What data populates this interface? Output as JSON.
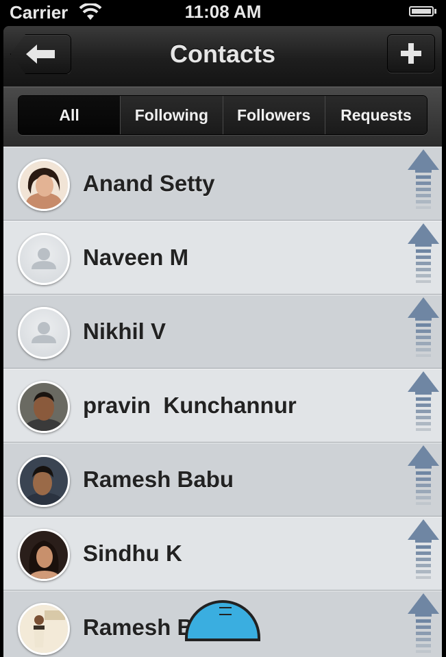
{
  "status_bar": {
    "carrier": "Carrier",
    "time": "11:08 AM"
  },
  "nav": {
    "title": "Contacts",
    "back_icon": "back-arrow-icon",
    "add_icon": "plus-icon"
  },
  "segments": [
    "All",
    "Following",
    "Followers",
    "Requests"
  ],
  "selected_segment": "All",
  "contacts": [
    {
      "name": "Anand Setty",
      "avatar": "photo"
    },
    {
      "name": "Naveen M",
      "avatar": "placeholder"
    },
    {
      "name": "Nikhil V",
      "avatar": "placeholder"
    },
    {
      "name": "pravin  Kunchannur",
      "avatar": "photo"
    },
    {
      "name": "Ramesh Babu",
      "avatar": "photo"
    },
    {
      "name": "Sindhu K",
      "avatar": "photo"
    },
    {
      "name": "Ramesh Babu",
      "avatar": "photo"
    }
  ],
  "colors": {
    "row_odd": "#ced2d6",
    "row_even": "#e1e4e7",
    "arrow": "#6f86a3",
    "handle": "#3aaee0"
  }
}
